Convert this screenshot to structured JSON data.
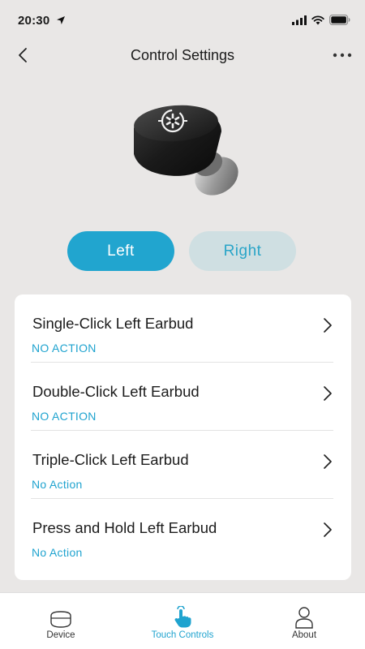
{
  "status_bar": {
    "time": "20:30"
  },
  "header": {
    "title": "Control Settings"
  },
  "side_toggle": {
    "left_label": "Left",
    "right_label": "Right",
    "selected": "Left"
  },
  "settings": {
    "rows": [
      {
        "label": "Single-Click Left Earbud",
        "value": "NO ACTION"
      },
      {
        "label": "Double-Click Left Earbud",
        "value": "NO ACTION"
      },
      {
        "label": "Triple-Click Left Earbud",
        "value": "No Action"
      },
      {
        "label": "Press and Hold Left Earbud",
        "value": "No Action"
      }
    ]
  },
  "bottom_nav": {
    "items": [
      {
        "label": "Device",
        "icon": "earbud-case-icon"
      },
      {
        "label": "Touch Controls",
        "icon": "touch-hand-icon",
        "active": true
      },
      {
        "label": "About",
        "icon": "person-icon"
      }
    ]
  },
  "colors": {
    "accent": "#21a5cf",
    "background": "#e9e7e6",
    "toggle_inactive_bg": "#cfdfe2"
  }
}
